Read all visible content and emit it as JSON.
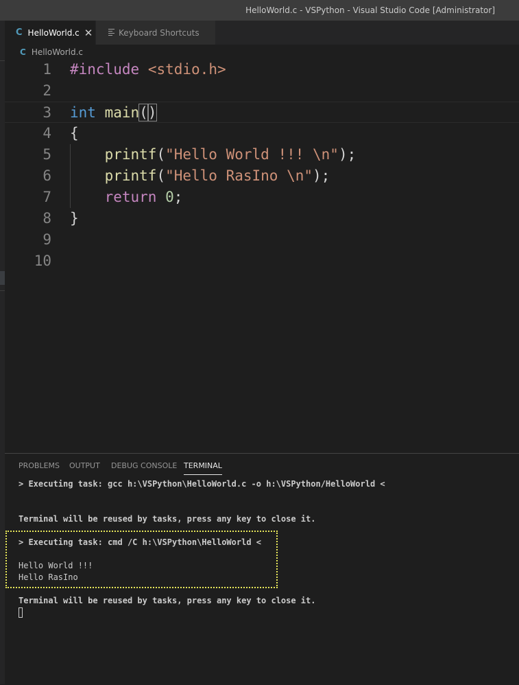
{
  "window": {
    "title": "HelloWorld.c - VSPython - Visual Studio Code [Administrator]"
  },
  "tabs": [
    {
      "label": "HelloWorld.c",
      "icon": "c-file-icon",
      "glyph": "C",
      "active": true,
      "close_glyph": "✕"
    },
    {
      "label": "Keyboard Shortcuts",
      "icon": "keyboard-shortcuts-icon",
      "active": false
    }
  ],
  "breadcrumb": {
    "glyph": "C",
    "file": "HelloWorld.c"
  },
  "editor": {
    "line_numbers": [
      "1",
      "2",
      "3",
      "4",
      "5",
      "6",
      "7",
      "8",
      "9",
      "10"
    ],
    "lines": [
      {
        "pp": "#include",
        "header": "<stdio.h>"
      },
      {},
      {
        "type": "int",
        "name": "main",
        "open": "(",
        "close": ")"
      },
      {
        "text": "{"
      },
      {
        "fn": "printf",
        "open": "(",
        "str": "\"Hello World !!! \\n\"",
        "close": ");"
      },
      {
        "fn": "printf",
        "open": "(",
        "str": "\"Hello RasIno \\n\"",
        "close": ");"
      },
      {
        "kw": "return",
        "num": "0",
        "end": ";"
      },
      {
        "text": "}"
      },
      {},
      {}
    ]
  },
  "panel": {
    "tabs": [
      "PROBLEMS",
      "OUTPUT",
      "DEBUG CONSOLE",
      "TERMINAL"
    ],
    "active_tab": "TERMINAL",
    "terminal": [
      "> Executing task: gcc h:\\VSPython\\HelloWorld.c -o h:\\VSPython/HelloWorld <",
      "Terminal will be reused by tasks, press any key to close it.",
      "> Executing task: cmd /C h:\\VSPython\\HelloWorld <",
      "Hello World !!!",
      "Hello RasIno",
      "Terminal will be reused by tasks, press any key to close it."
    ]
  },
  "colors": {
    "background": "#1e1e1e",
    "keyword": "#569cd6",
    "control": "#c586c0",
    "function": "#dcdcaa",
    "string": "#ce9178",
    "number": "#b5cea8",
    "highlight_border": "#e8e85a"
  }
}
